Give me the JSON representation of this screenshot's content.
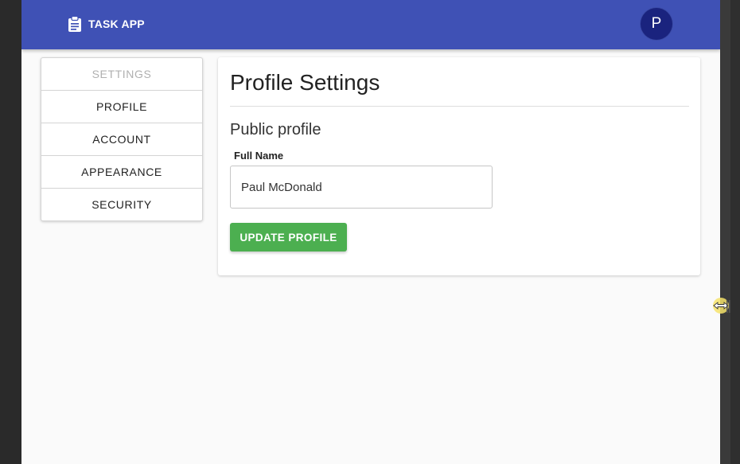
{
  "appbar": {
    "brand_text": "TASK APP",
    "brand_icon": "clipboard-icon",
    "brand_color": "#3f51b5",
    "avatar_letter": "P",
    "avatar_color": "#1a237e"
  },
  "sidenav": {
    "header": "SETTINGS",
    "items": [
      {
        "label": "PROFILE"
      },
      {
        "label": "ACCOUNT"
      },
      {
        "label": "APPEARANCE"
      },
      {
        "label": "SECURITY"
      }
    ]
  },
  "main": {
    "title": "Profile Settings",
    "section_title": "Public profile",
    "full_name_label": "Full Name",
    "full_name_value": "Paul McDonald",
    "update_button_label": "UPDATE PROFILE",
    "update_button_color": "#4caf50"
  },
  "cursor": {
    "icon": "horizontal-resize-cursor-icon"
  }
}
